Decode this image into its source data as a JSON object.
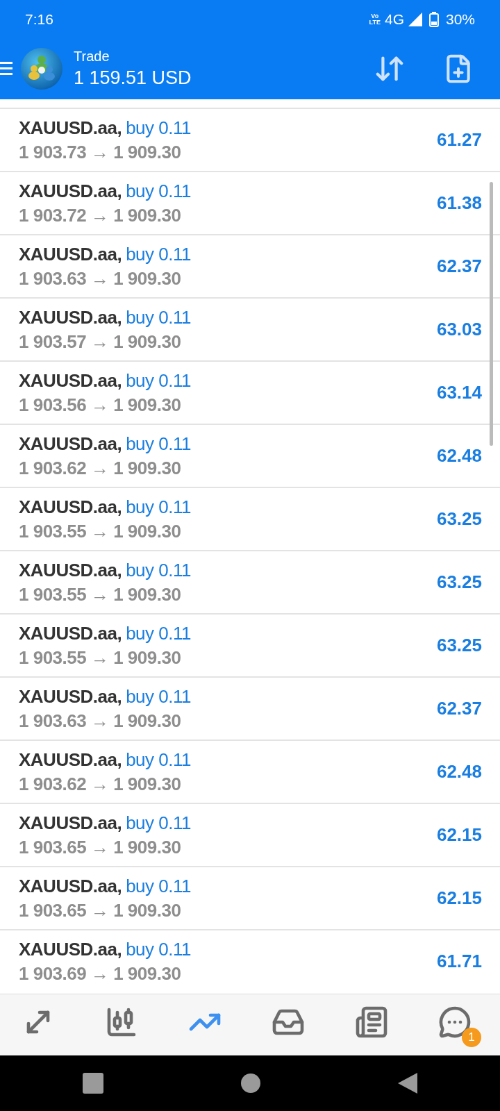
{
  "status_bar": {
    "time": "7:16",
    "volte": [
      "Vo",
      "LTE"
    ],
    "network": "4G",
    "battery": "30%"
  },
  "app_bar": {
    "title": "Trade",
    "balance": "1 159.51 USD"
  },
  "positions": [
    {
      "symbol": "XAUUSD.aa,",
      "side": "buy 0.11",
      "prices": "1 903.73 → 1 909.30",
      "profit": "61.27"
    },
    {
      "symbol": "XAUUSD.aa,",
      "side": "buy 0.11",
      "prices": "1 903.72 → 1 909.30",
      "profit": "61.38"
    },
    {
      "symbol": "XAUUSD.aa,",
      "side": "buy 0.11",
      "prices": "1 903.63 → 1 909.30",
      "profit": "62.37"
    },
    {
      "symbol": "XAUUSD.aa,",
      "side": "buy 0.11",
      "prices": "1 903.57 → 1 909.30",
      "profit": "63.03"
    },
    {
      "symbol": "XAUUSD.aa,",
      "side": "buy 0.11",
      "prices": "1 903.56 → 1 909.30",
      "profit": "63.14"
    },
    {
      "symbol": "XAUUSD.aa,",
      "side": "buy 0.11",
      "prices": "1 903.62 → 1 909.30",
      "profit": "62.48"
    },
    {
      "symbol": "XAUUSD.aa,",
      "side": "buy 0.11",
      "prices": "1 903.55 → 1 909.30",
      "profit": "63.25"
    },
    {
      "symbol": "XAUUSD.aa,",
      "side": "buy 0.11",
      "prices": "1 903.55 → 1 909.30",
      "profit": "63.25"
    },
    {
      "symbol": "XAUUSD.aa,",
      "side": "buy 0.11",
      "prices": "1 903.55 → 1 909.30",
      "profit": "63.25"
    },
    {
      "symbol": "XAUUSD.aa,",
      "side": "buy 0.11",
      "prices": "1 903.63 → 1 909.30",
      "profit": "62.37"
    },
    {
      "symbol": "XAUUSD.aa,",
      "side": "buy 0.11",
      "prices": "1 903.62 → 1 909.30",
      "profit": "62.48"
    },
    {
      "symbol": "XAUUSD.aa,",
      "side": "buy 0.11",
      "prices": "1 903.65 → 1 909.30",
      "profit": "62.15"
    },
    {
      "symbol": "XAUUSD.aa,",
      "side": "buy 0.11",
      "prices": "1 903.65 → 1 909.30",
      "profit": "62.15"
    },
    {
      "symbol": "XAUUSD.aa,",
      "side": "buy 0.11",
      "prices": "1 903.69 → 1 909.30",
      "profit": "61.71"
    }
  ],
  "bottom_nav": [
    {
      "kind": "quotes",
      "selected": false
    },
    {
      "kind": "chart",
      "selected": false
    },
    {
      "kind": "trade",
      "selected": true
    },
    {
      "kind": "history",
      "selected": false
    },
    {
      "kind": "news",
      "selected": false
    },
    {
      "kind": "messages",
      "selected": false,
      "badge": "1"
    }
  ]
}
